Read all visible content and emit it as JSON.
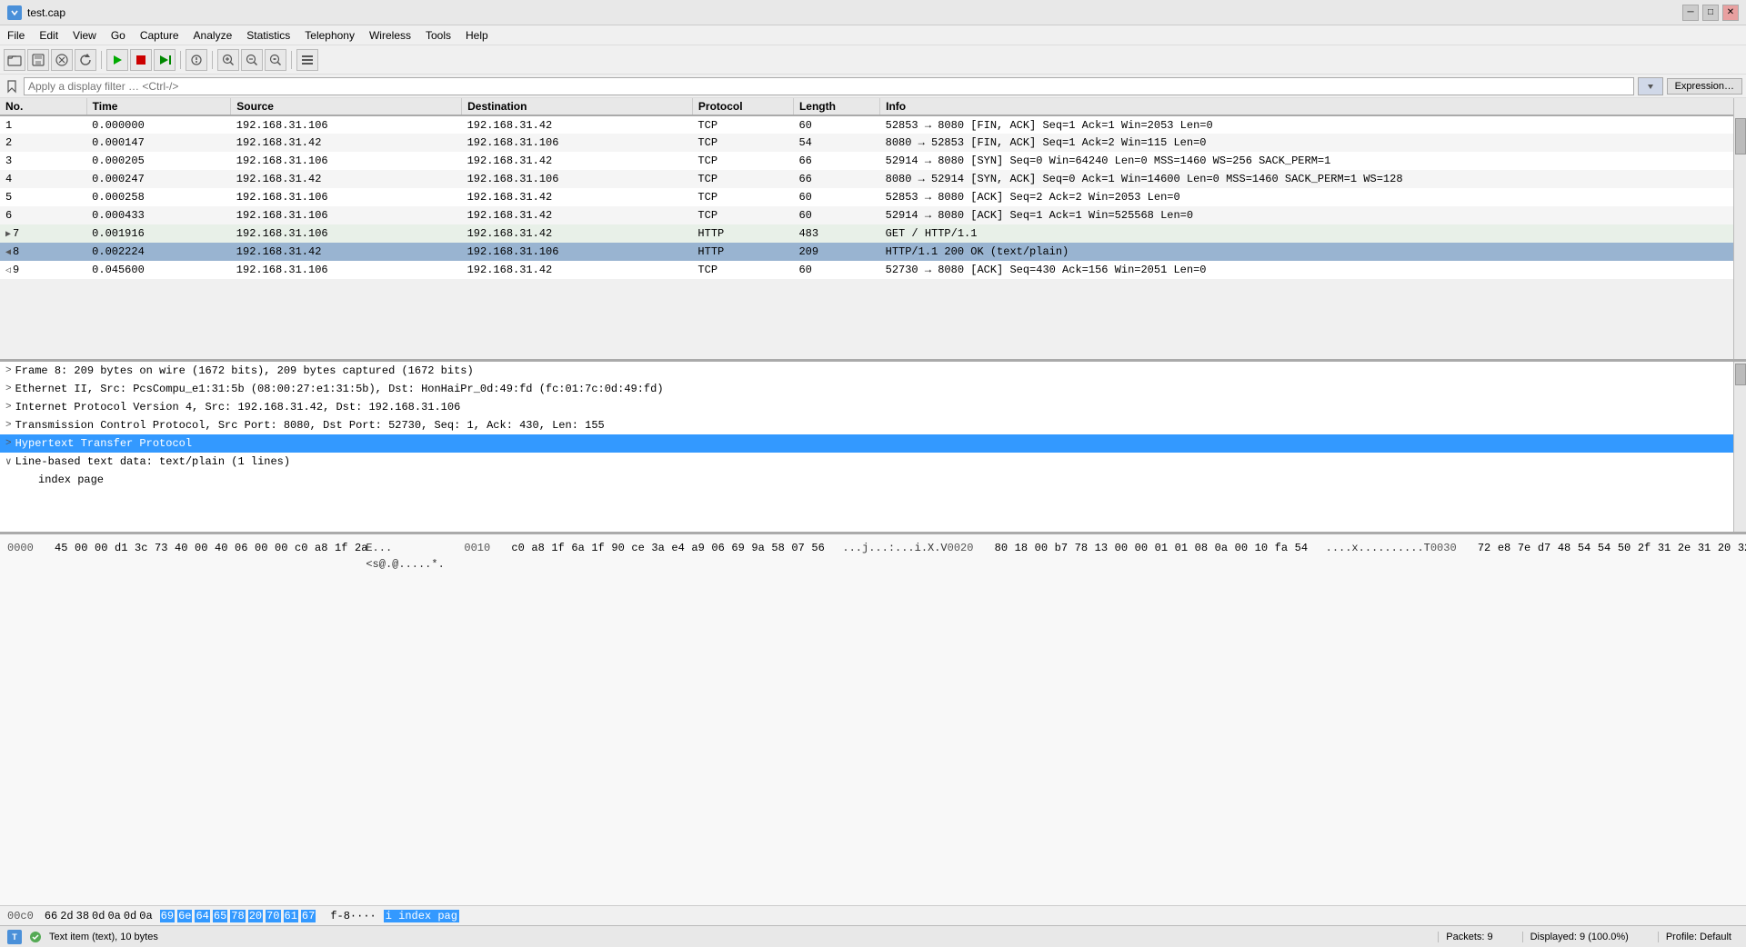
{
  "titlebar": {
    "icon": "W",
    "title": "test.cap",
    "minimize": "─",
    "maximize": "□",
    "close": "✕"
  },
  "menu": {
    "items": [
      "File",
      "Edit",
      "View",
      "Go",
      "Capture",
      "Analyze",
      "Statistics",
      "Telephony",
      "Wireless",
      "Tools",
      "Help"
    ]
  },
  "toolbar": {
    "buttons": [
      "📂",
      "💾",
      "⊙",
      "✕",
      "📋",
      "✂",
      "↩",
      "↪",
      "▶",
      "⏸",
      "⏹",
      "▶▶",
      "⟳",
      "🔍",
      "🔍+",
      "🔍-",
      "🔍⇔",
      "⚙"
    ]
  },
  "filter": {
    "placeholder": "Apply a display filter … <Ctrl-/>",
    "expression_btn": "Expression…"
  },
  "columns": {
    "no": "No.",
    "time": "Time",
    "source": "Source",
    "destination": "Destination",
    "protocol": "Protocol",
    "length": "Length",
    "info": "Info"
  },
  "packets": [
    {
      "no": "1",
      "time": "0.000000",
      "source": "192.168.31.106",
      "destination": "192.168.31.42",
      "protocol": "TCP",
      "length": "60",
      "info": "52853 → 8080 [FIN, ACK] Seq=1 Ack=1 Win=2053 Len=0",
      "style": "normal",
      "arrow": ""
    },
    {
      "no": "2",
      "time": "0.000147",
      "source": "192.168.31.42",
      "destination": "192.168.31.106",
      "protocol": "TCP",
      "length": "54",
      "info": "8080 → 52853 [FIN, ACK] Seq=1 Ack=2 Win=115 Len=0",
      "style": "normal",
      "arrow": ""
    },
    {
      "no": "3",
      "time": "0.000205",
      "source": "192.168.31.106",
      "destination": "192.168.31.42",
      "protocol": "TCP",
      "length": "66",
      "info": "52914 → 8080 [SYN] Seq=0 Win=64240 Len=0 MSS=1460 WS=256 SACK_PERM=1",
      "style": "normal",
      "arrow": ""
    },
    {
      "no": "4",
      "time": "0.000247",
      "source": "192.168.31.42",
      "destination": "192.168.31.106",
      "protocol": "TCP",
      "length": "66",
      "info": "8080 → 52914 [SYN, ACK] Seq=0 Ack=1 Win=14600 Len=0 MSS=1460 SACK_PERM=1 WS=128",
      "style": "normal",
      "arrow": ""
    },
    {
      "no": "5",
      "time": "0.000258",
      "source": "192.168.31.106",
      "destination": "192.168.31.42",
      "protocol": "TCP",
      "length": "60",
      "info": "52853 → 8080 [ACK] Seq=2 Ack=2 Win=2053 Len=0",
      "style": "normal",
      "arrow": ""
    },
    {
      "no": "6",
      "time": "0.000433",
      "source": "192.168.31.106",
      "destination": "192.168.31.42",
      "protocol": "TCP",
      "length": "60",
      "info": "52914 → 8080 [ACK] Seq=1 Ack=1 Win=525568 Len=0",
      "style": "normal",
      "arrow": ""
    },
    {
      "no": "7",
      "time": "0.001916",
      "source": "192.168.31.106",
      "destination": "192.168.31.42",
      "protocol": "HTTP",
      "length": "483",
      "info": "GET / HTTP/1.1",
      "style": "http",
      "arrow": "in"
    },
    {
      "no": "8",
      "time": "0.002224",
      "source": "192.168.31.42",
      "destination": "192.168.31.106",
      "protocol": "HTTP",
      "length": "209",
      "info": "HTTP/1.1 200 OK   (text/plain)",
      "style": "http-selected",
      "arrow": "out"
    },
    {
      "no": "9",
      "time": "0.045600",
      "source": "192.168.31.106",
      "destination": "192.168.31.42",
      "protocol": "TCP",
      "length": "60",
      "info": "52730 → 8080 [ACK] Seq=430 Ack=156 Win=2051 Len=0",
      "style": "normal",
      "arrow": "out-line"
    }
  ],
  "detail_rows": [
    {
      "id": "frame",
      "toggle": ">",
      "text": "Frame 8: 209 bytes on wire (1672 bits), 209 bytes captured (1672 bits)",
      "indent": 0,
      "selected": false
    },
    {
      "id": "ethernet",
      "toggle": ">",
      "text": "Ethernet II, Src: PcsCompu_e1:31:5b (08:00:27:e1:31:5b), Dst: HonHaiPr_0d:49:fd (fc:01:7c:0d:49:fd)",
      "indent": 0,
      "selected": false
    },
    {
      "id": "ip",
      "toggle": ">",
      "text": "Internet Protocol Version 4, Src: 192.168.31.42, Dst: 192.168.31.106",
      "indent": 0,
      "selected": false
    },
    {
      "id": "tcp",
      "toggle": ">",
      "text": "Transmission Control Protocol, Src Port: 8080, Dst Port: 52730, Seq: 1, Ack: 430, Len: 155",
      "indent": 0,
      "selected": false
    },
    {
      "id": "http",
      "toggle": ">",
      "text": "Hypertext Transfer Protocol",
      "indent": 0,
      "selected": true
    },
    {
      "id": "linedata",
      "toggle": "∨",
      "text": "Line-based text data: text/plain (1 lines)",
      "indent": 0,
      "selected": false
    },
    {
      "id": "indexpage",
      "toggle": "",
      "text": "index page",
      "indent": 1,
      "selected": false
    }
  ],
  "hex": {
    "offset_label": "00c0",
    "bytes_plain": "66 2d 38 0d 0a 0d 0a",
    "bytes_highlighted": "69 6e 64 65 78 20 70 61 67",
    "ascii_plain": "f-8····",
    "ascii_highlighted": "i index pag"
  },
  "statusbar": {
    "left_icon": "T",
    "status_text": "Text item (text), 10 bytes",
    "packets": "Packets: 9",
    "displayed": "Displayed: 9 (100.0%)",
    "profile": "Profile: Default"
  }
}
